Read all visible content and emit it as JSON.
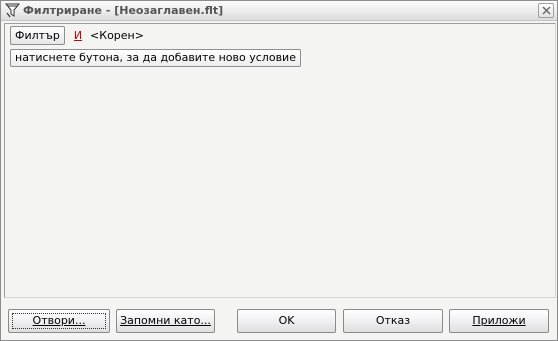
{
  "window": {
    "title": "Филтриране - [Неозаглавен.flt]",
    "icon": "filter-funnel-icon",
    "close_icon": "close-icon"
  },
  "filter": {
    "filter_button_label": "Филтър",
    "and_link_label": "И",
    "root_label": "<Корен>",
    "add_condition_label": "натиснете бутона, за да добавите ново условие",
    "and_link_color": "#cc0000"
  },
  "buttons": {
    "open_label": "Отвори...",
    "save_as_label": "Запомни като...",
    "ok_label": "OK",
    "cancel_label": "Отказ",
    "apply_label": "Приложи"
  }
}
